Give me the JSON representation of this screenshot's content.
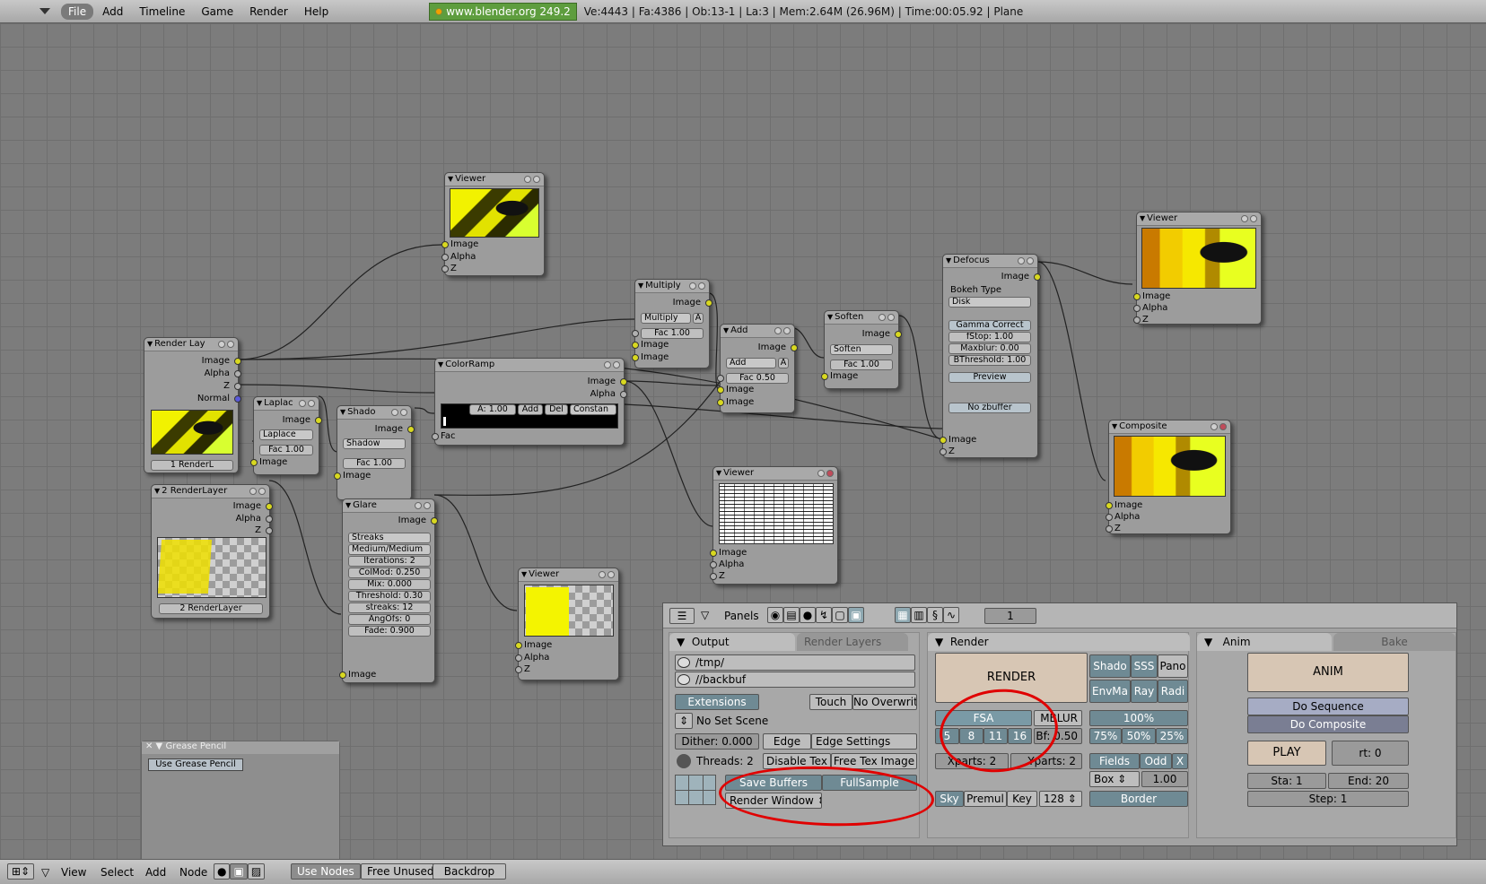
{
  "menu": {
    "items": [
      "File",
      "Add",
      "Timeline",
      "Game",
      "Render",
      "Help"
    ]
  },
  "info": {
    "url": "www.blender.org 249.2",
    "stats": "Ve:4443 | Fa:4386 | Ob:13-1 | La:3  | Mem:2.64M (26.96M)  | Time:00:05.92 | Plane"
  },
  "nodes": {
    "viewer1": {
      "title": "Viewer",
      "sockets": [
        "Image",
        "Alpha",
        "Z"
      ]
    },
    "render_layers": {
      "title": "Render Lay",
      "outputs": [
        "Image",
        "Alpha",
        "Z",
        "Normal"
      ],
      "layer": "1 RenderL"
    },
    "laplace": {
      "title": "Laplac",
      "out": "Image",
      "mode": "Laplace",
      "fac": "Fac 1.00",
      "in": "Image"
    },
    "shadow": {
      "title": "Shado",
      "out": "Image",
      "mode": "Shadow",
      "fac": "Fac 1.00",
      "in": "Image"
    },
    "colorramp": {
      "title": "ColorRamp",
      "out_image": "Image",
      "out_alpha": "Alpha",
      "a": "A: 1.00",
      "add": "Add",
      "del": "Del",
      "interp": "Constan",
      "in": "Fac"
    },
    "multiply": {
      "title": "Multiply",
      "out": "Image",
      "mode": "Multiply",
      "a_btn": "A",
      "fac": "Fac 1.00",
      "in1": "Image",
      "in2": "Image"
    },
    "add": {
      "title": "Add",
      "out": "Image",
      "mode": "Add",
      "a_btn": "A",
      "fac": "Fac 0.50",
      "in1": "Image",
      "in2": "Image"
    },
    "soften": {
      "title": "Soften",
      "out": "Image",
      "mode": "Soften",
      "fac": "Fac 1.00",
      "in": "Image"
    },
    "defocus": {
      "title": "Defocus",
      "out": "Image",
      "bokeh_label": "Bokeh Type",
      "bokeh": "Disk",
      "gamma": "Gamma Correct",
      "fstop": "fStop: 1.00",
      "maxblur": "Maxblur: 0.00",
      "bthreshold": "BThreshold: 1.00",
      "preview": "Preview",
      "nozbuffer": "No zbuffer",
      "in1": "Image",
      "in2": "Z"
    },
    "viewer2": {
      "title": "Viewer",
      "sockets": [
        "Image",
        "Alpha",
        "Z"
      ]
    },
    "composite": {
      "title": "Composite",
      "sockets": [
        "Image",
        "Alpha",
        "Z"
      ]
    },
    "viewer3": {
      "title": "Viewer",
      "sockets": [
        "Image",
        "Alpha",
        "Z"
      ]
    },
    "render_layers2": {
      "title": "2 RenderLayer",
      "outputs": [
        "Image",
        "Alpha",
        "Z"
      ],
      "layer": "2 RenderLayer"
    },
    "glare": {
      "title": "Glare",
      "out": "Image",
      "fields": [
        "Streaks",
        "Medium/Medium",
        "Iterations: 2",
        "ColMod: 0.250",
        "Mix: 0.000",
        "Threshold: 0.30",
        "streaks: 12",
        "AngOfs: 0",
        "Fade: 0.900"
      ],
      "in": "Image"
    },
    "viewer4": {
      "title": "Viewer",
      "sockets": [
        "Image",
        "Alpha",
        "Z"
      ]
    }
  },
  "grease_pencil": {
    "title": "Grease Pencil",
    "button": "Use Grease Pencil"
  },
  "buttons": {
    "panels_label": "Panels",
    "frame": "1",
    "output": {
      "tab": "Output",
      "tab2": "Render Layers",
      "path1": "/tmp/",
      "path2": "//backbuf",
      "extensions": "Extensions",
      "touch": "Touch",
      "no_overwrite": "No Overwrite",
      "no_set_scene": "No Set Scene",
      "dither": "Dither: 0.000",
      "edge": "Edge",
      "edge_settings": "Edge Settings",
      "threads": "Threads: 2",
      "disable_tex": "Disable Tex",
      "free_tex": "Free Tex Image",
      "save_buffers": "Save Buffers",
      "fullsample": "FullSample",
      "render_window": "Render Window"
    },
    "render": {
      "tab": "Render",
      "render_btn": "RENDER",
      "shado": "Shado",
      "sss": "SSS",
      "pano": "Pano",
      "envma": "EnvMa",
      "ray": "Ray",
      "radi": "Radi",
      "fsa": "FSA",
      "fsa_values": [
        "5",
        "8",
        "11",
        "16"
      ],
      "mblur": "MBLUR",
      "bf": "Bf: 0.50",
      "pct100": "100%",
      "pct75": "75%",
      "pct50": "50%",
      "pct25": "25%",
      "xparts": "Xparts: 2",
      "yparts": "Yparts: 2",
      "fields": "Fields",
      "odd": "Odd",
      "x": "X",
      "box": "Box",
      "box_val": "1.00",
      "sky": "Sky",
      "premul": "Premul",
      "key": "Key",
      "bits": "128",
      "border": "Border"
    },
    "anim": {
      "tab": "Anim",
      "tab2": "Bake",
      "anim_btn": "ANIM",
      "do_sequence": "Do Sequence",
      "do_composite": "Do Composite",
      "play": "PLAY",
      "rt": "rt: 0",
      "sta": "Sta: 1",
      "end": "End: 20",
      "step": "Step: 1"
    }
  },
  "footer": {
    "menus": [
      "View",
      "Select",
      "Add",
      "Node"
    ],
    "use_nodes": "Use Nodes",
    "free_unused": "Free Unused",
    "backdrop": "Backdrop"
  }
}
